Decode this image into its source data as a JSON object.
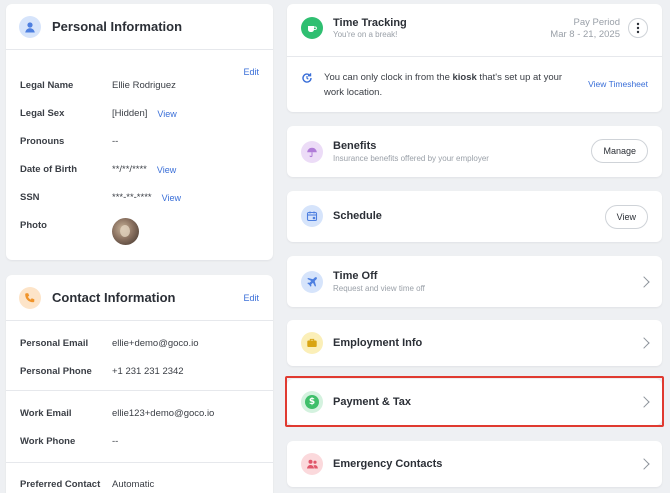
{
  "personal": {
    "title": "Personal Information",
    "edit": "Edit",
    "rows": [
      {
        "label": "Legal Name",
        "value": "Ellie Rodriguez",
        "view": ""
      },
      {
        "label": "Legal Sex",
        "value": "[Hidden]",
        "view": "View"
      },
      {
        "label": "Pronouns",
        "value": "--",
        "view": ""
      },
      {
        "label": "Date of Birth",
        "value": "**/**/****",
        "view": "View"
      },
      {
        "label": "SSN",
        "value": "***-**-****",
        "view": "View"
      },
      {
        "label": "Photo",
        "value": "",
        "view": ""
      }
    ]
  },
  "contact": {
    "title": "Contact Information",
    "edit": "Edit",
    "rows": [
      {
        "label": "Personal Email",
        "value": "ellie+demo@goco.io"
      },
      {
        "label": "Personal Phone",
        "value": "+1 231 231 2342"
      },
      {
        "label": "Work Email",
        "value": "ellie123+demo@goco.io"
      },
      {
        "label": "Work Phone",
        "value": "--"
      },
      {
        "label": "Preferred Contact",
        "value": "Automatic"
      }
    ]
  },
  "time_tracking": {
    "title": "Time Tracking",
    "subtitle": "You're on a break!",
    "pay_period_label": "Pay Period",
    "pay_period_value": "Mar 8 - 21, 2025",
    "notice_pre": "You can only clock in from the ",
    "notice_bold": "kiosk",
    "notice_post": " that's set up at your work location.",
    "view_timesheet": "View Timesheet"
  },
  "benefits": {
    "title": "Benefits",
    "subtitle": "Insurance benefits offered by your employer",
    "button": "Manage"
  },
  "schedule": {
    "title": "Schedule",
    "button": "View"
  },
  "time_off": {
    "title": "Time Off",
    "subtitle": "Request and view time off"
  },
  "employment": {
    "title": "Employment Info"
  },
  "payment": {
    "title": "Payment & Tax"
  },
  "emergency": {
    "title": "Emergency Contacts"
  },
  "colors": {
    "accent_blue": "#3a6fd8",
    "highlight_red": "#e03a30",
    "time_green": "#2fbf71",
    "benefits_purple": "#b07cd8",
    "payment_green": "#3fbf6a"
  }
}
